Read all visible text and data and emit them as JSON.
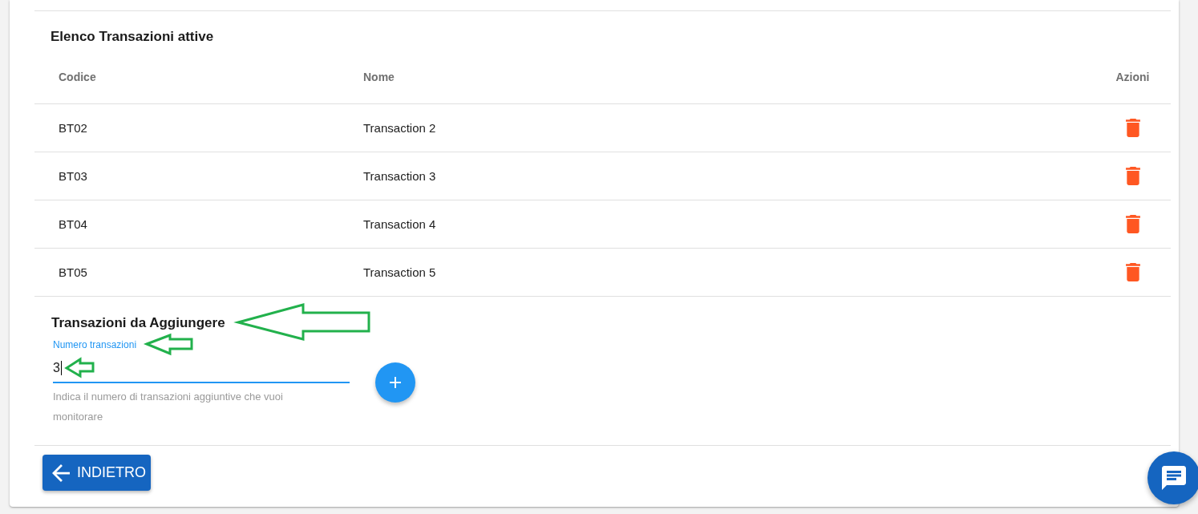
{
  "active_transactions": {
    "title": "Elenco Transazioni attive",
    "columns": [
      "Codice",
      "Nome",
      "Azioni"
    ],
    "rows": [
      {
        "code": "BT02",
        "name": "Transaction 2"
      },
      {
        "code": "BT03",
        "name": "Transaction 3"
      },
      {
        "code": "BT04",
        "name": "Transaction 4"
      },
      {
        "code": "BT05",
        "name": "Transaction 5"
      }
    ]
  },
  "add_transactions": {
    "title": "Transazioni da Aggiungere",
    "field": {
      "label": "Numero transazioni",
      "value": "3",
      "helper": "Indica il numero di transazioni aggiuntive che vuoi monitorare",
      "focused": true
    }
  },
  "back_button": {
    "label": "INDIETRO"
  }
}
